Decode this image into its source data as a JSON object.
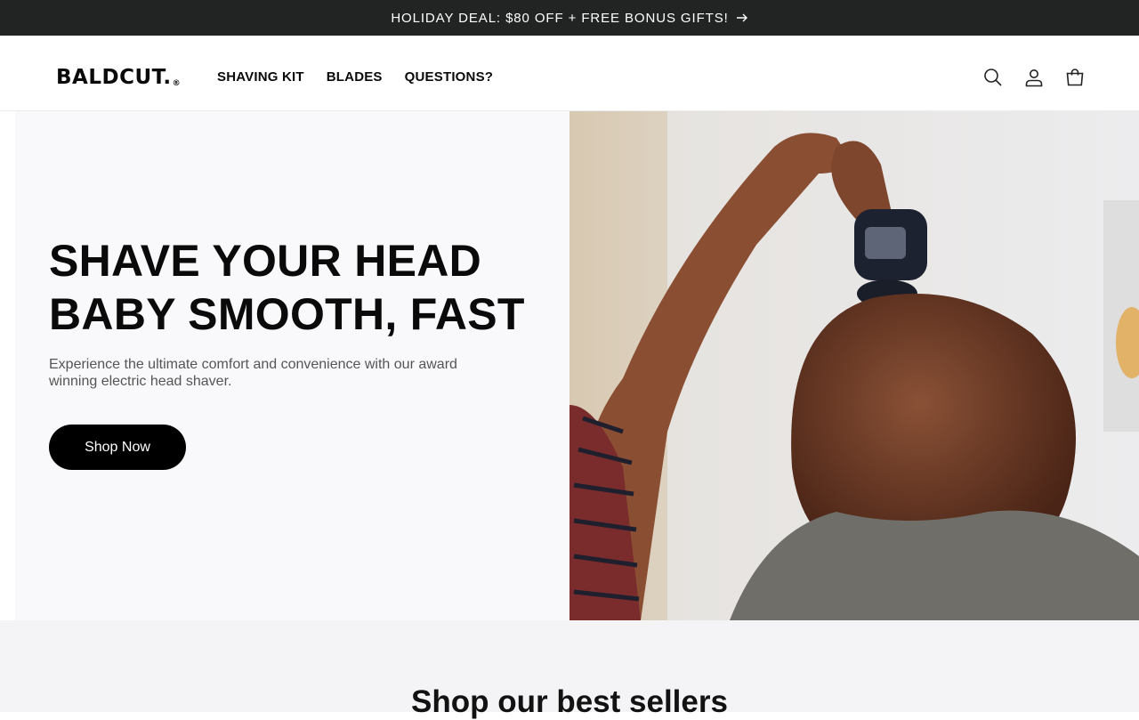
{
  "announcement": {
    "text": "HOLIDAY DEAL: $80 OFF + FREE BONUS GIFTS!",
    "icon": "arrow-right-icon"
  },
  "header": {
    "logo_text": "BALDCUT.",
    "logo_mark": "®",
    "nav": [
      {
        "label": "SHAVING KIT"
      },
      {
        "label": "BLADES"
      },
      {
        "label": "QUESTIONS?"
      }
    ],
    "icons": [
      "search-icon",
      "account-icon",
      "cart-icon"
    ]
  },
  "hero": {
    "title_line1": "SHAVE YOUR HEAD",
    "title_line2": "BABY SMOOTH, FAST",
    "subtitle": "Experience the ultimate comfort and convenience with our award winning electric head shaver.",
    "cta_label": "Shop Now"
  },
  "best_sellers": {
    "title": "Shop our best sellers"
  },
  "colors": {
    "announcement_bg": "#222424",
    "button_bg": "#000000",
    "hero_bg": "#f9f9fb"
  }
}
